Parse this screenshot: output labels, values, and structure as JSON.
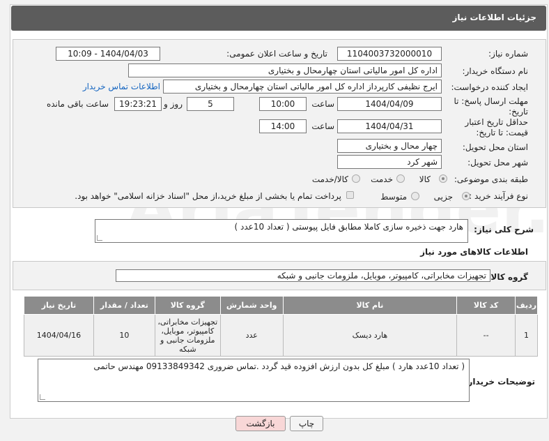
{
  "header": {
    "title": "جزئیات اطلاعات نیاز"
  },
  "form": {
    "need_number": {
      "label": "شماره نیاز:",
      "value": "1104003732000010"
    },
    "announce_datetime": {
      "label": "تاریخ و ساعت اعلان عمومی:",
      "value": "1404/04/03 - 10:09"
    },
    "buyer_org": {
      "label": "نام دستگاه خریدار:",
      "value": "اداره کل امور مالیاتی استان چهارمحال و بختیاری"
    },
    "requester": {
      "label": "ایجاد کننده درخواست:",
      "value": "ایرج نظیفی کارپرداز اداره کل امور مالیاتی استان چهارمحال و بختیاری",
      "contact_link": "اطلاعات تماس خریدار"
    },
    "reply_deadline": {
      "label": "مهلت ارسال پاسخ: تا تاریخ:",
      "date": "1404/04/09",
      "time_label": "ساعت",
      "time": "10:00",
      "days": "5",
      "days_label": "روز و",
      "remaining": "19:23:21",
      "remaining_label": "ساعت باقی مانده"
    },
    "price_validity": {
      "label": "حداقل تاریخ اعتبار قیمت: تا تاریخ:",
      "date": "1404/04/31",
      "time_label": "ساعت",
      "time": "14:00"
    },
    "delivery_province": {
      "label": "استان محل تحویل:",
      "value": "چهار محال و بختیاری"
    },
    "delivery_city": {
      "label": "شهر محل تحویل:",
      "value": "شهر کرد"
    },
    "category": {
      "label": "طبقه بندی موضوعی:",
      "options": [
        "کالا",
        "خدمت",
        "کالا/خدمت"
      ],
      "selected": "کالا"
    },
    "process_type": {
      "label": "نوع فرآیند خرید :",
      "options": [
        "جزیی",
        "متوسط"
      ],
      "selected": "جزیی",
      "note": "پرداخت تمام یا بخشی از مبلغ خرید،از محل \"اسناد خزانه اسلامی\" خواهد بود."
    }
  },
  "description": {
    "label": "شرح کلی نیاز:",
    "value": "هارد جهت ذخیره سازی  کاملا مطابق فایل پیوستی    (   تعداد 10عدد   )"
  },
  "goods_info": {
    "title": "اطلاعات کالاهای مورد نیاز",
    "group_label": "گروه کالا:",
    "group_value": "تجهیزات مخابراتی، کامپیوتر، موبایل، ملزومات جانبی و شبکه"
  },
  "table": {
    "columns": [
      "ردیف",
      "کد کالا",
      "نام کالا",
      "واحد شمارش",
      "گروه کالا",
      "تعداد / مقدار",
      "تاریخ نیاز"
    ],
    "rows": [
      [
        "1",
        "--",
        "هارد دیسک",
        "عدد",
        "تجهیزات مخابراتی، کامپیوتر، موبایل، ملزومات جانبی و شبکه",
        "10",
        "1404/04/16"
      ]
    ]
  },
  "buyer_notes": {
    "label": "توضیحات خریدار:",
    "value": "( تعداد 10عدد  هارد  )   مبلغ کل بدون ارزش افزوده قید گردد .تماس ضروری 09133849342 مهندس حاتمی"
  },
  "buttons": {
    "print": "چاپ",
    "back": "بازگشت"
  },
  "colors": {
    "header_bg": "#5c5c5c",
    "table_header_bg": "#8c8c8c",
    "link": "#1565c0",
    "back_button_bg": "#f8d7d7"
  }
}
